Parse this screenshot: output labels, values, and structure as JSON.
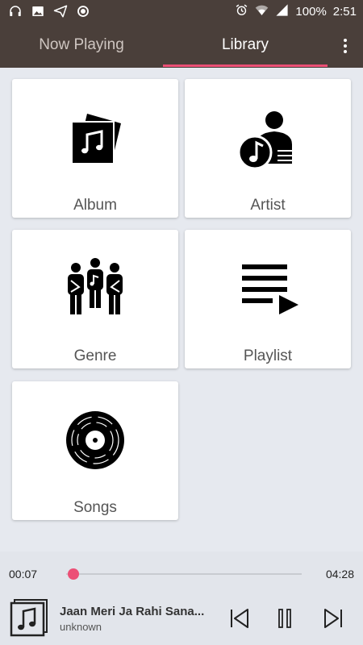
{
  "status_bar": {
    "battery": "100%",
    "time": "2:51",
    "left_icons": [
      "headphones-icon",
      "image-icon",
      "send-icon",
      "record-icon"
    ],
    "right_icons": [
      "alarm-icon",
      "wifi-icon",
      "signal-icon"
    ]
  },
  "tabs": {
    "now_playing": "Now Playing",
    "library": "Library",
    "active": "library",
    "accent_color": "#ec4f76",
    "header_color": "#4a3f3a"
  },
  "library": {
    "album": "Album",
    "artist": "Artist",
    "genre": "Genre",
    "playlist": "Playlist",
    "songs": "Songs"
  },
  "player": {
    "current_time": "00:07",
    "total_time": "04:28",
    "progress": 0.03,
    "title": "Jaan Meri Ja Rahi Sana...",
    "artist": "unknown",
    "icons": [
      "music-note-icon",
      "previous-icon",
      "pause-icon",
      "next-icon"
    ]
  }
}
